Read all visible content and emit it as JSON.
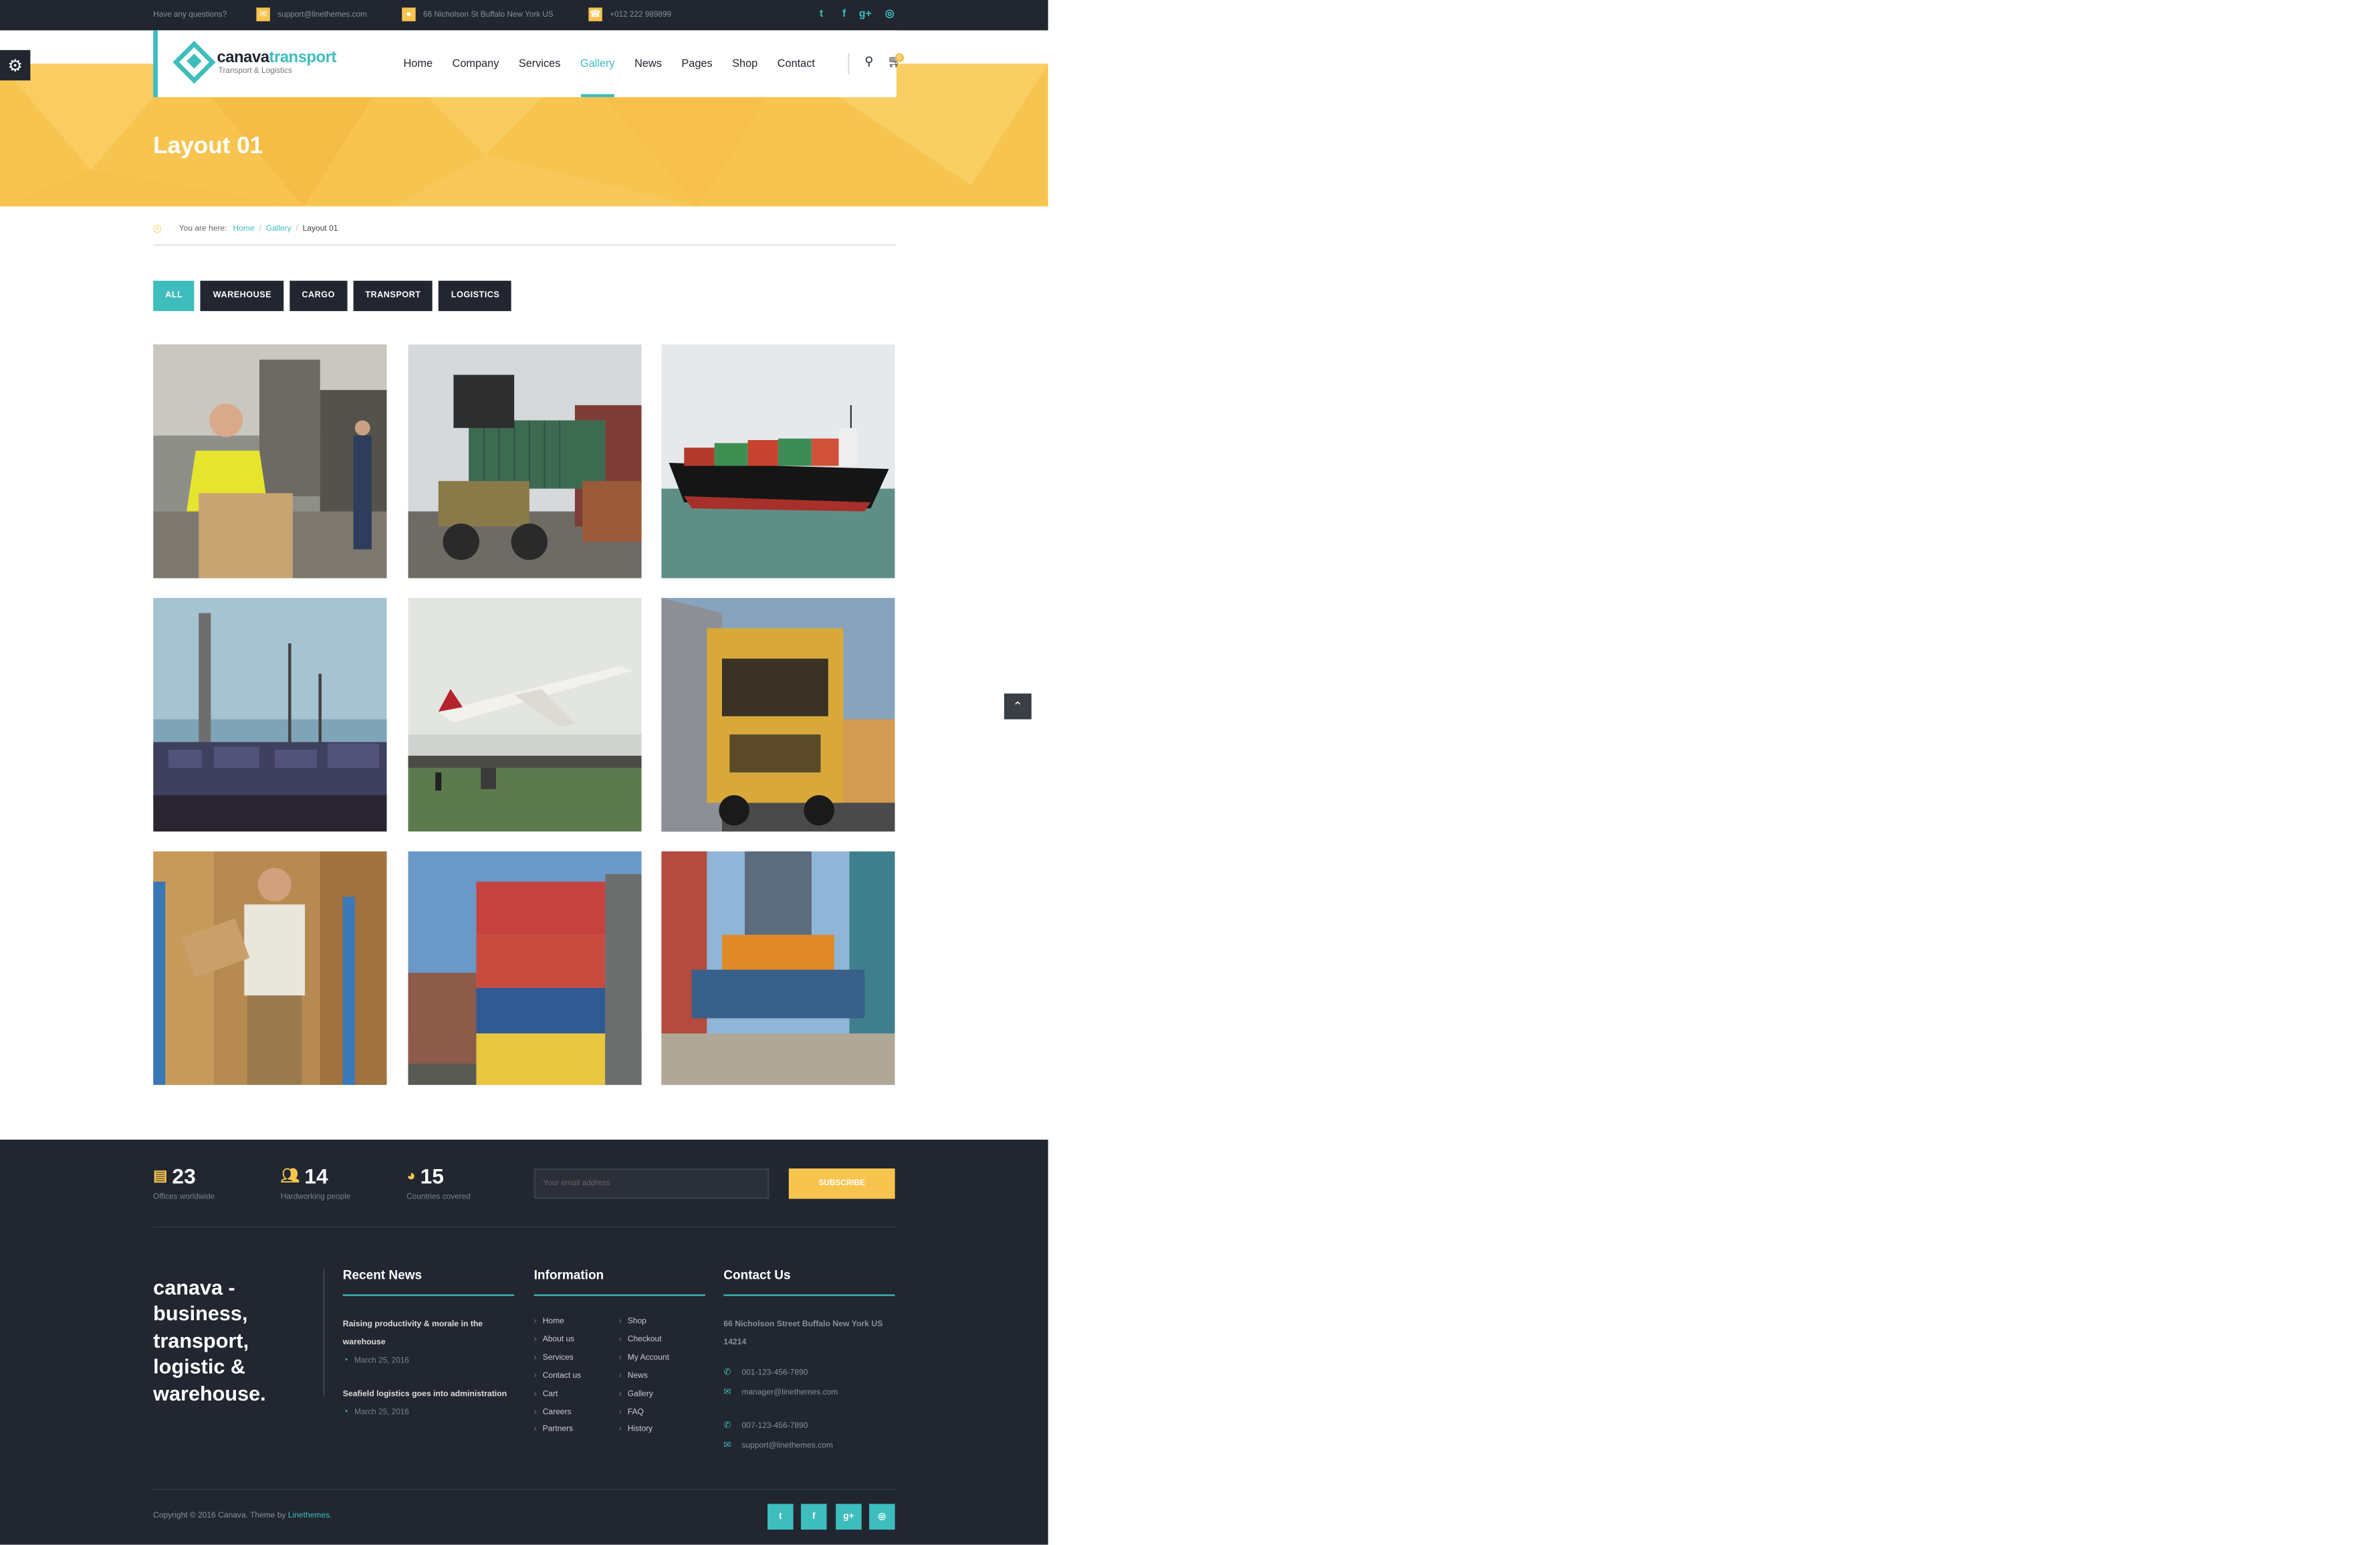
{
  "topbar": {
    "question": "Have any questions?",
    "email": "support@linethemes.com",
    "address": "66 Nicholson St Buffalo New York US",
    "phone": "+012 222 989899",
    "social": [
      "twitter-icon",
      "facebook-icon",
      "google-plus-icon",
      "dribbble-icon"
    ]
  },
  "header": {
    "logo_main": "canava",
    "logo_accent": "transport",
    "logo_sub": "Transport & Logistics",
    "nav": [
      "Home",
      "Company",
      "Services",
      "Gallery",
      "News",
      "Pages",
      "Shop",
      "Contact"
    ],
    "active_nav": "Gallery",
    "cart_count": "0"
  },
  "banner": {
    "title": "Layout 01"
  },
  "breadcrumb": {
    "label": "You are here:",
    "items": [
      "Home",
      "Gallery"
    ],
    "current": "Layout 01"
  },
  "filters": [
    "ALL",
    "WAREHOUSE",
    "CARGO",
    "TRANSPORT",
    "LOGISTICS"
  ],
  "active_filter": "ALL",
  "gallery": [
    {
      "alt": "Warehouse worker carrying a box",
      "category": "WAREHOUSE"
    },
    {
      "alt": "Container loader lifting a container",
      "category": "CARGO"
    },
    {
      "alt": "Container ship at sea",
      "category": "TRANSPORT"
    },
    {
      "alt": "Industrial port with containers",
      "category": "LOGISTICS"
    },
    {
      "alt": "Emirates airplane taking off",
      "category": "TRANSPORT"
    },
    {
      "alt": "Yellow truck on road at sunset",
      "category": "TRANSPORT"
    },
    {
      "alt": "Smiling man holding a box in warehouse",
      "category": "WAREHOUSE"
    },
    {
      "alt": "Stacked shipping containers",
      "category": "CARGO"
    },
    {
      "alt": "Crane lifting a container",
      "category": "LOGISTICS"
    }
  ],
  "footer": {
    "stats": [
      {
        "value": "23",
        "label": "Offices worldwide",
        "icon": "building-icon"
      },
      {
        "value": "14",
        "label": "Hardworking people",
        "icon": "people-icon"
      },
      {
        "value": "15",
        "label": "Countries covered",
        "icon": "globe-icon"
      }
    ],
    "newsletter_placeholder": "Your email address",
    "subscribe": "SUBSCRIBE",
    "tagline": "canava - business, transport, logistic & warehouse.",
    "recent_news": {
      "title": "Recent News",
      "items": [
        {
          "title": "Raising productivity & morale in the warehouse",
          "date": "March 25, 2016"
        },
        {
          "title": "Seafield logistics goes into administration",
          "date": "March 25, 2016"
        }
      ]
    },
    "information": {
      "title": "Information",
      "col1": [
        "Home",
        "About us",
        "Services",
        "Contact us",
        "Cart",
        "Careers",
        "Partners"
      ],
      "col2": [
        "Shop",
        "Checkout",
        "My Account",
        "News",
        "Gallery",
        "FAQ",
        "History"
      ]
    },
    "contact": {
      "title": "Contact Us",
      "address": "66 Nicholson Street Buffalo New York US 14214",
      "phone1": "001-123-456-7890",
      "email1": "manager@linethemes.com",
      "phone2": "007-123-456-7890",
      "email2": "support@linethemes.com"
    },
    "copyright_prefix": "Copyright © 2016 Canava. Theme by ",
    "copyright_link": "Linethemes.",
    "social": [
      "twitter-icon",
      "facebook-icon",
      "google-plus-icon",
      "dribbble-icon"
    ]
  },
  "colors": {
    "accent": "#3ebdbd",
    "yellow": "#f7c44f",
    "dark": "#212630"
  }
}
